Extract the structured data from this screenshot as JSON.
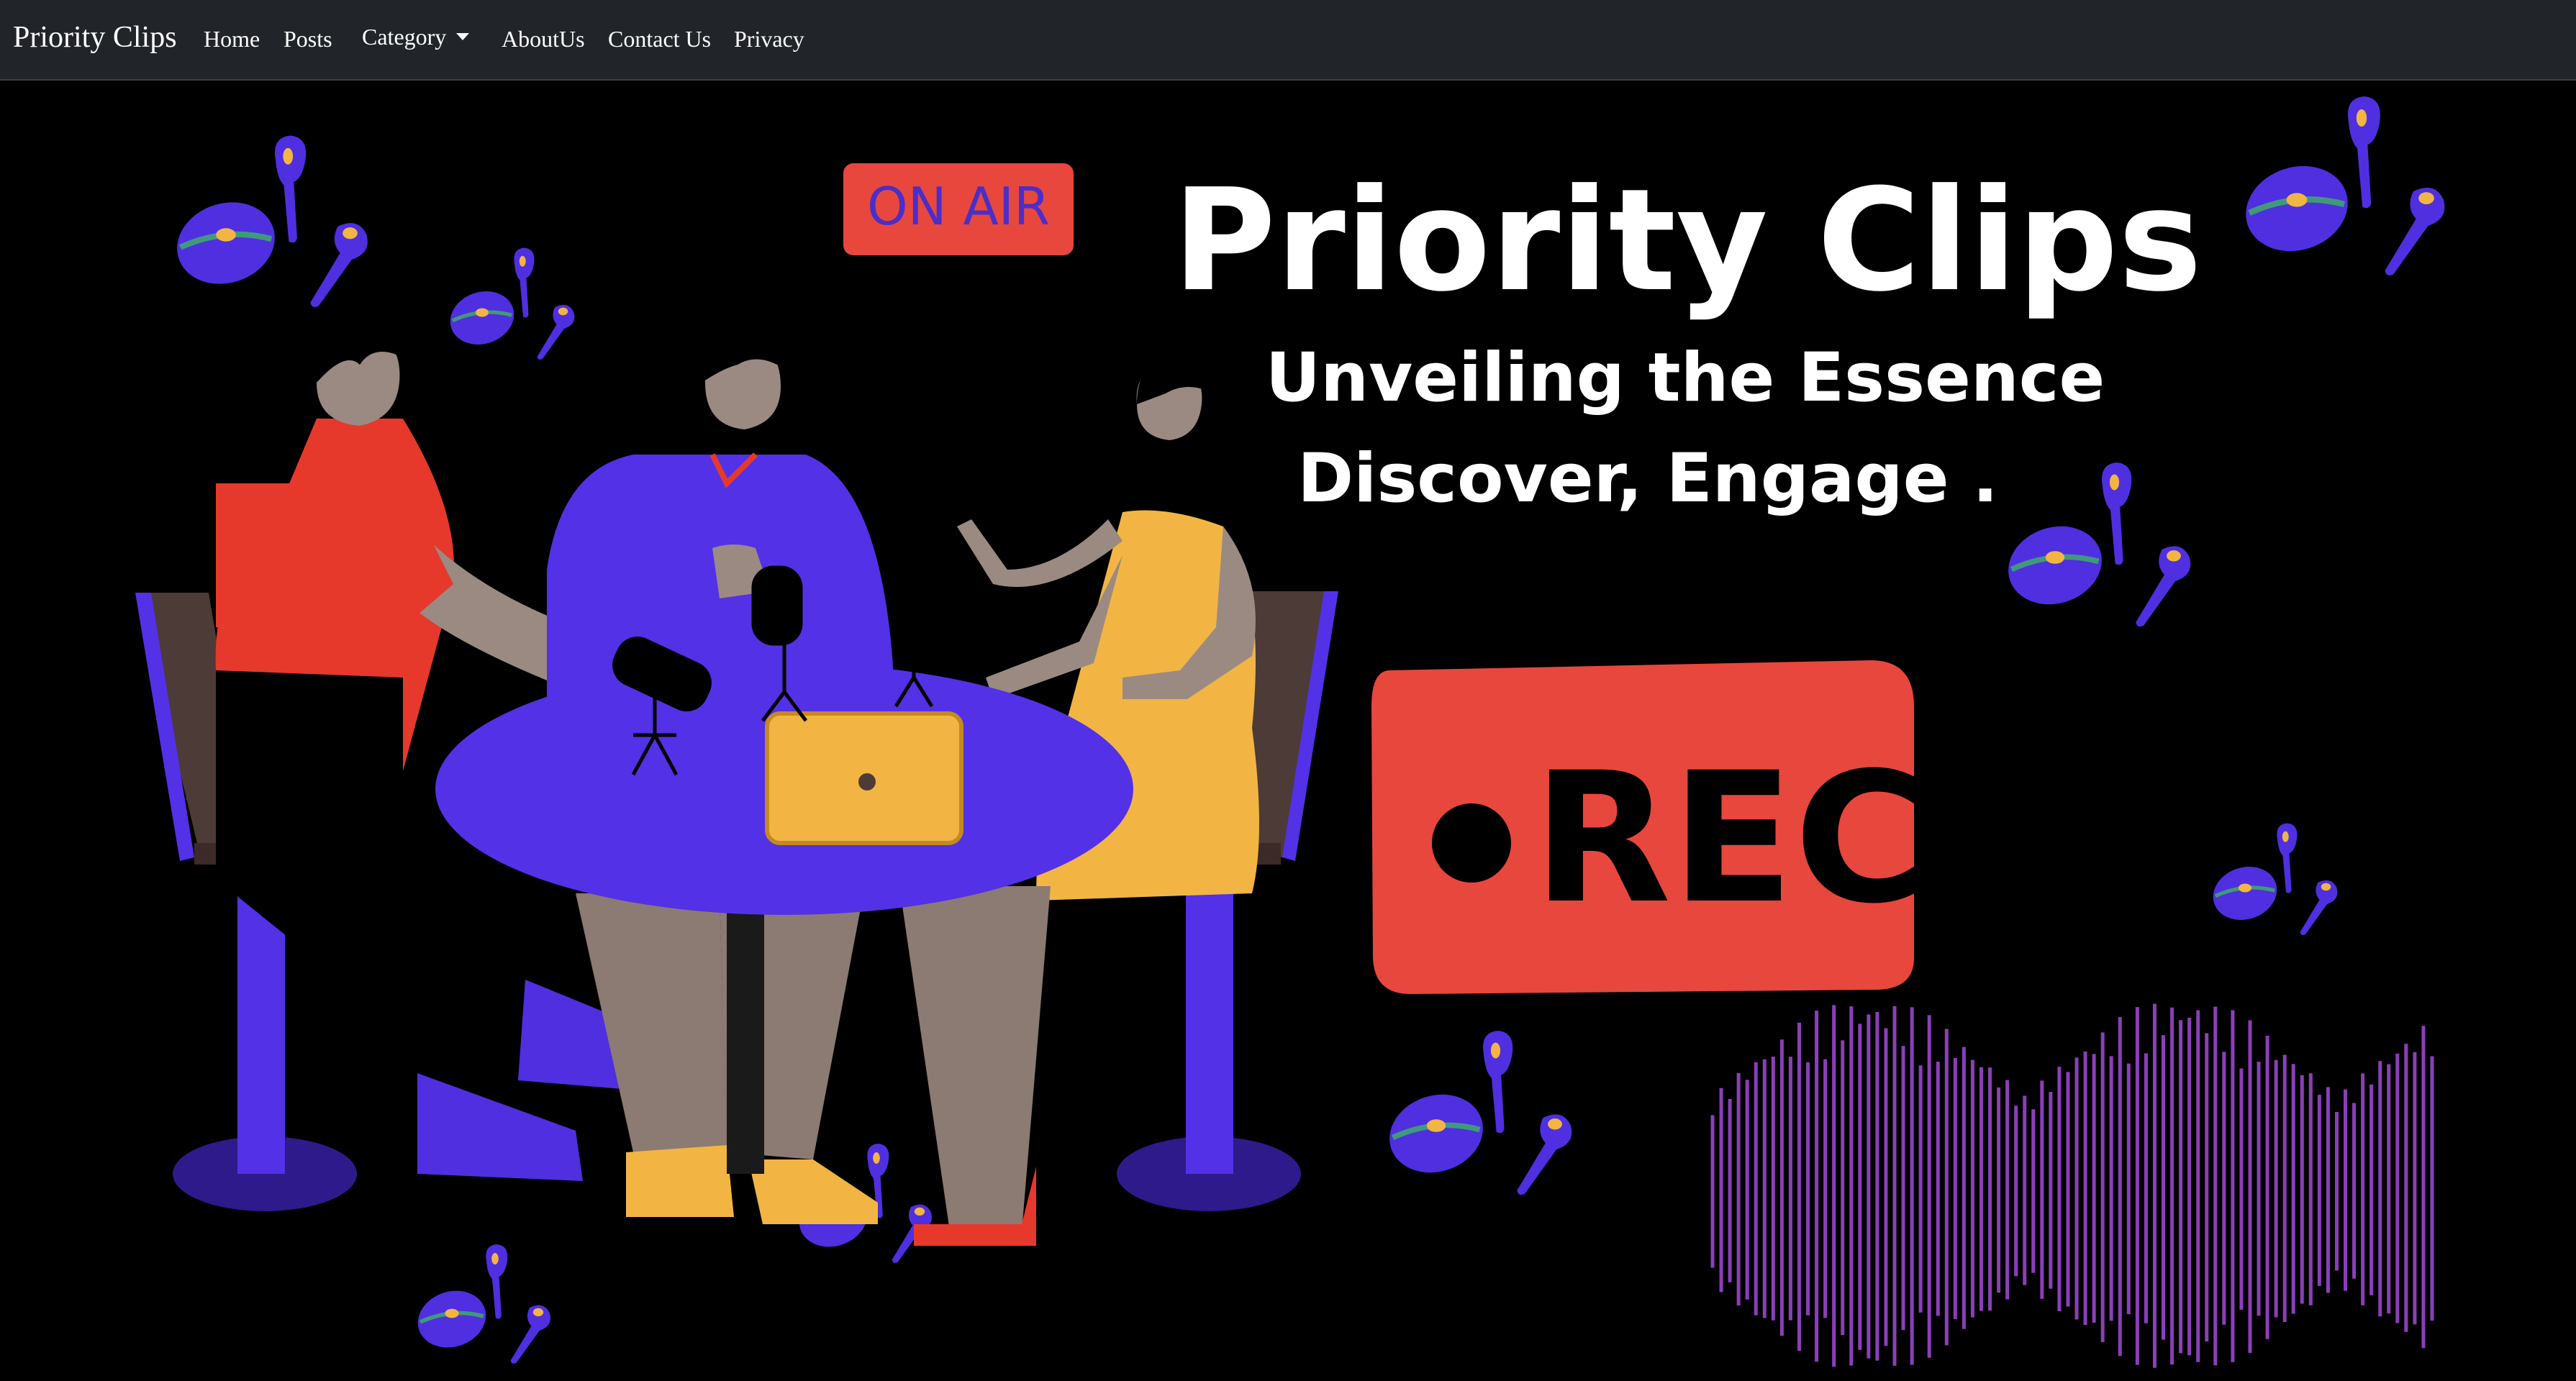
{
  "navbar": {
    "brand": "Priority Clips",
    "links": [
      "Home",
      "Posts",
      "Category",
      "AboutUs",
      "Contact Us",
      "Privacy"
    ]
  },
  "hero": {
    "on_air_sign": "ON AIR",
    "title": "Priority Clips",
    "tagline_1": "Unveiling the Essence",
    "tagline_2": "Discover, Engage .",
    "rec_sign": "REC"
  },
  "colors": {
    "navbar_bg": "#212529",
    "page_bg": "#000000",
    "accent_purple": "#4f2fe0",
    "rec_red": "#e8473d",
    "on_air_text": "#4a2ec9",
    "dress_yellow": "#f2b544",
    "waveform": "#8a3fb8"
  },
  "icons": [
    "earbuds-case-icon",
    "earbud-icon",
    "microphone-icon"
  ]
}
